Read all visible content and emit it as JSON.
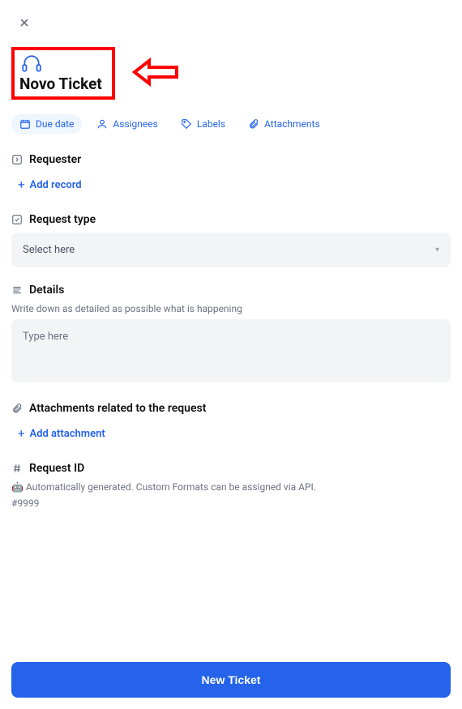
{
  "title": "Novo Ticket",
  "chips": {
    "due_date": "Due date",
    "assignees": "Assignees",
    "labels": "Labels",
    "attachments": "Attachments"
  },
  "sections": {
    "requester": {
      "title": "Requester",
      "add": "Add record"
    },
    "request_type": {
      "title": "Request type",
      "placeholder": "Select here"
    },
    "details": {
      "title": "Details",
      "subtitle": "Write down as detailed as possible what is happening",
      "placeholder": "Type here"
    },
    "attachments_related": {
      "title": "Attachments related to the request",
      "add": "Add attachment"
    },
    "request_id": {
      "title": "Request ID",
      "subtitle": "🤖 Automatically generated. Custom Formats can be assigned via API.",
      "value": "#9999"
    }
  },
  "submit_label": "New Ticket"
}
